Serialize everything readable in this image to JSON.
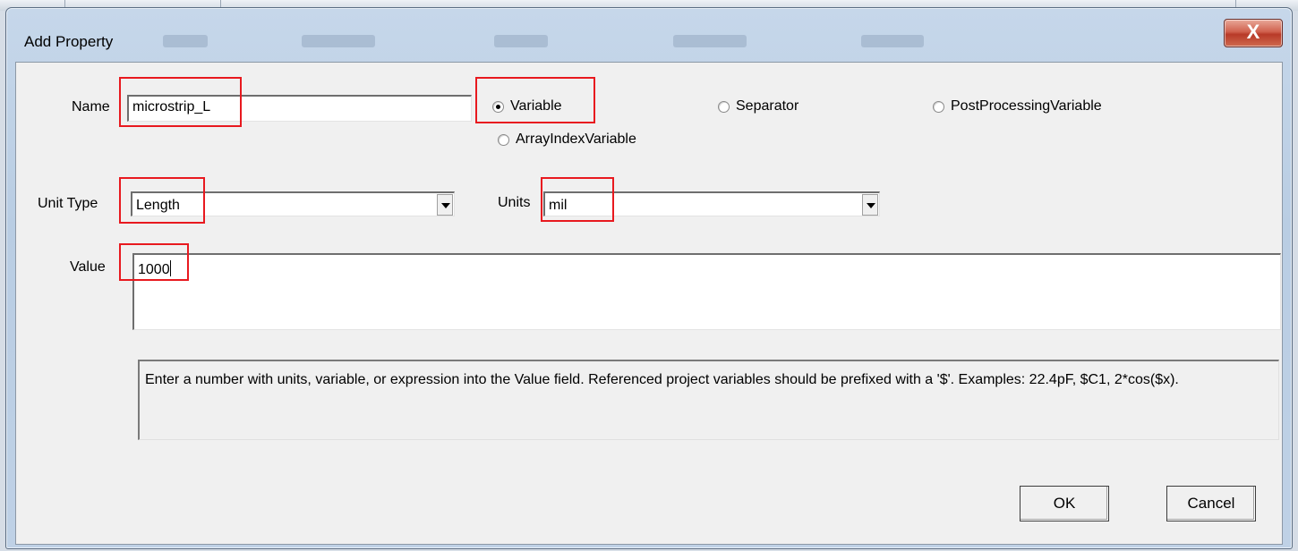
{
  "dialog": {
    "title": "Add Property",
    "close_label": "X"
  },
  "form": {
    "name_label": "Name",
    "name_value": "microstrip_L",
    "unit_type_label": "Unit Type",
    "unit_type_value": "Length",
    "units_label": "Units",
    "units_value": "mil",
    "value_label": "Value",
    "value_value": "1000"
  },
  "property_kind": {
    "options": [
      "Variable",
      "Separator",
      "PostProcessingVariable",
      "ArrayIndexVariable"
    ],
    "selected": "Variable"
  },
  "hint_text": "Enter a number with units, variable, or expression into the Value field. Referenced project variables should be prefixed with a '$'. Examples: 22.4pF, $C1, 2*cos($x).",
  "buttons": {
    "ok": "OK",
    "cancel": "Cancel"
  },
  "colors": {
    "highlight": "#e8191f",
    "close_button": "#c9503c"
  }
}
